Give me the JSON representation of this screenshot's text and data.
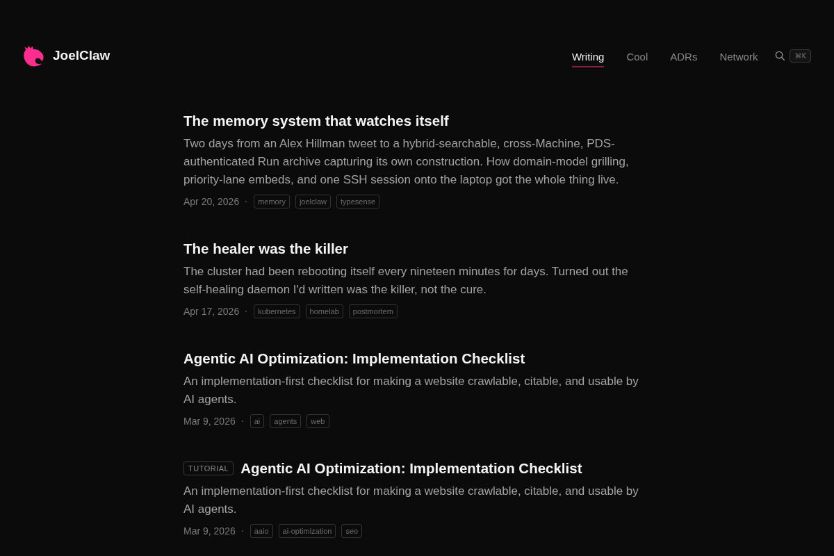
{
  "header": {
    "logo": {
      "text": "JoelClaw"
    },
    "nav": [
      {
        "label": "Writing",
        "selected": true
      },
      {
        "label": "Cool",
        "selected": false
      },
      {
        "label": "ADRs",
        "selected": false
      },
      {
        "label": "Network",
        "selected": false
      }
    ],
    "search": {
      "shortcut": "⌘K"
    }
  },
  "posts": [
    {
      "title": "The memory system that watches itself",
      "summary": "Two days from an Alex Hillman tweet to a hybrid-searchable, cross-Machine, PDS-authenticated Run archive capturing its own construction. How domain-model grilling, priority-lane embeds, and one SSH session onto the laptop got the whole thing live.",
      "date": "Apr 20, 2026",
      "tags": [
        "memory",
        "joelclaw",
        "typesense"
      ]
    },
    {
      "title": "The healer was the killer",
      "summary": "The cluster had been rebooting itself every nineteen minutes for days. Turned out the self-healing daemon I'd written was the killer, not the cure.",
      "date": "Apr 17, 2026",
      "tags": [
        "kubernetes",
        "homelab",
        "postmortem"
      ]
    },
    {
      "title": "Agentic AI Optimization: Implementation Checklist",
      "summary": "An implementation-first checklist for making a website crawlable, citable, and usable by AI agents.",
      "date": "Mar 9, 2026",
      "tags": [
        "ai",
        "agents",
        "web"
      ]
    },
    {
      "badge": "TUTORIAL",
      "title": "Agentic AI Optimization: Implementation Checklist",
      "summary": "An implementation-first checklist for making a website crawlable, citable, and usable by AI agents.",
      "date": "Mar 9, 2026",
      "tags": [
        "aaio",
        "ai-optimization",
        "seo"
      ]
    }
  ]
}
